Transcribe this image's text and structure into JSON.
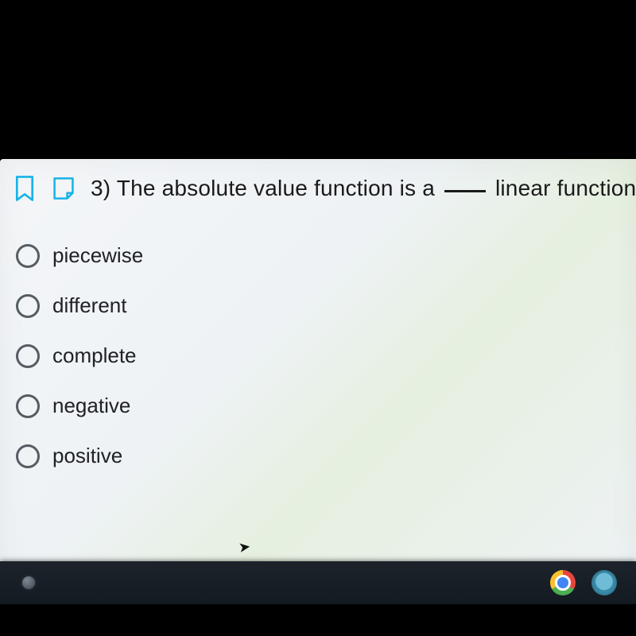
{
  "question": {
    "number": "3)",
    "text_before": "The absolute value function is a",
    "text_after": "linear function."
  },
  "options": [
    {
      "label": "piecewise"
    },
    {
      "label": "different"
    },
    {
      "label": "complete"
    },
    {
      "label": "negative"
    },
    {
      "label": "positive"
    }
  ],
  "icons": {
    "bookmark": "bookmark-icon",
    "note": "note-icon",
    "launcher": "launcher-icon",
    "chrome": "chrome-icon",
    "camera": "camera-icon"
  }
}
